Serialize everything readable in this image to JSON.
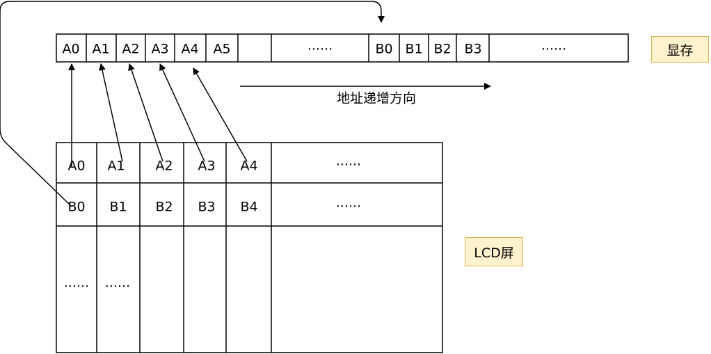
{
  "vram": {
    "label": "显存",
    "cells": [
      "A0",
      "A1",
      "A2",
      "A3",
      "A4",
      "A5",
      "",
      "......",
      "B0",
      "B1",
      "B2",
      "B3",
      "......"
    ]
  },
  "direction_label": "地址递增方向",
  "lcd": {
    "label": "LCD屏",
    "row_a": [
      "A0",
      "A1",
      "A2",
      "A3",
      "A4",
      "......"
    ],
    "row_b": [
      "B0",
      "B1",
      "B2",
      "B3",
      "B4",
      "......"
    ],
    "row_rest": [
      "......",
      "......"
    ]
  },
  "colors": {
    "tag_fill": "#fff2cc",
    "tag_border": "#d6b656",
    "line": "#000000"
  }
}
